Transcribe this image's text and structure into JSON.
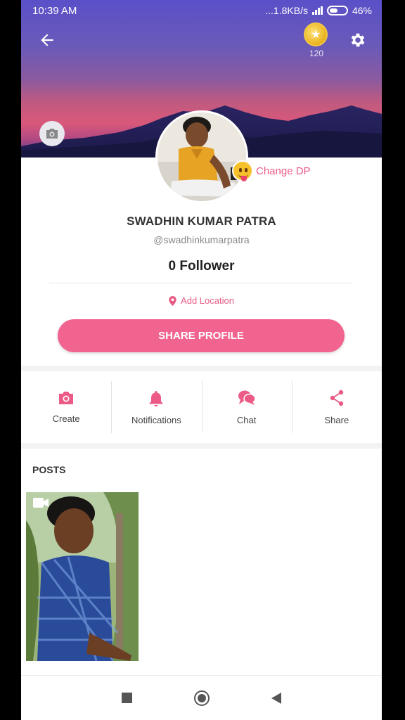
{
  "status_bar": {
    "time": "10:39 AM",
    "network_speed": "...1.8KB/s",
    "battery": "46%"
  },
  "header": {
    "coin_count": "120"
  },
  "profile": {
    "change_dp_label": "Change DP",
    "name": "SWADHIN KUMAR PATRA",
    "handle": "@swadhinkumarpatra",
    "followers": "0 Follower",
    "location_label": "Add Location",
    "share_button": "SHARE PROFILE"
  },
  "actions": [
    {
      "label": "Create",
      "icon": "camera-icon"
    },
    {
      "label": "Notifications",
      "icon": "bell-icon"
    },
    {
      "label": "Chat",
      "icon": "chat-bubbles-icon"
    },
    {
      "label": "Share",
      "icon": "share-icon"
    }
  ],
  "posts": {
    "title": "POSTS"
  },
  "colors": {
    "accent": "#f26490",
    "accent_text": "#e85b84"
  }
}
